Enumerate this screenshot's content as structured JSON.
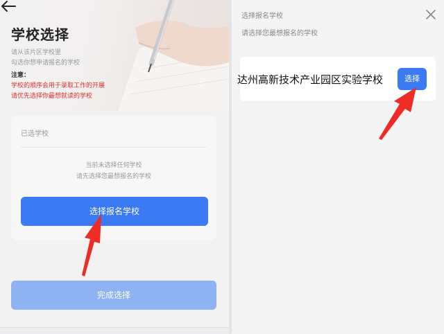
{
  "left_screen": {
    "title": "学校选择",
    "desc_line1": "请从该片区学校里",
    "desc_line2": "勾选你想申请报名的学校",
    "note_head": "注意：",
    "note_red1": "学校的顺序会用于录取工作的开展",
    "note_red2": "请优先选择你最想就读的学校",
    "selected_label": "已选学校",
    "empty_line1": "当前未选择任何学校",
    "empty_line2": "请先选择您最想报名的学校",
    "select_button": "选择报名学校",
    "done_button": "完成选择"
  },
  "right_screen": {
    "title": "选择报名学校",
    "subtitle": "请选择您最想报名的学校",
    "school_name": "达州高新技术产业园区实验学校",
    "choose_button": "选择"
  },
  "colors": {
    "primary": "#3b7af2",
    "primary_disabled": "#8eb2f2",
    "warning_red": "#d8342f",
    "annotation_arrow": "#ee2b24"
  },
  "icons": {
    "back": "arrow-left-icon",
    "close": "close-icon"
  }
}
